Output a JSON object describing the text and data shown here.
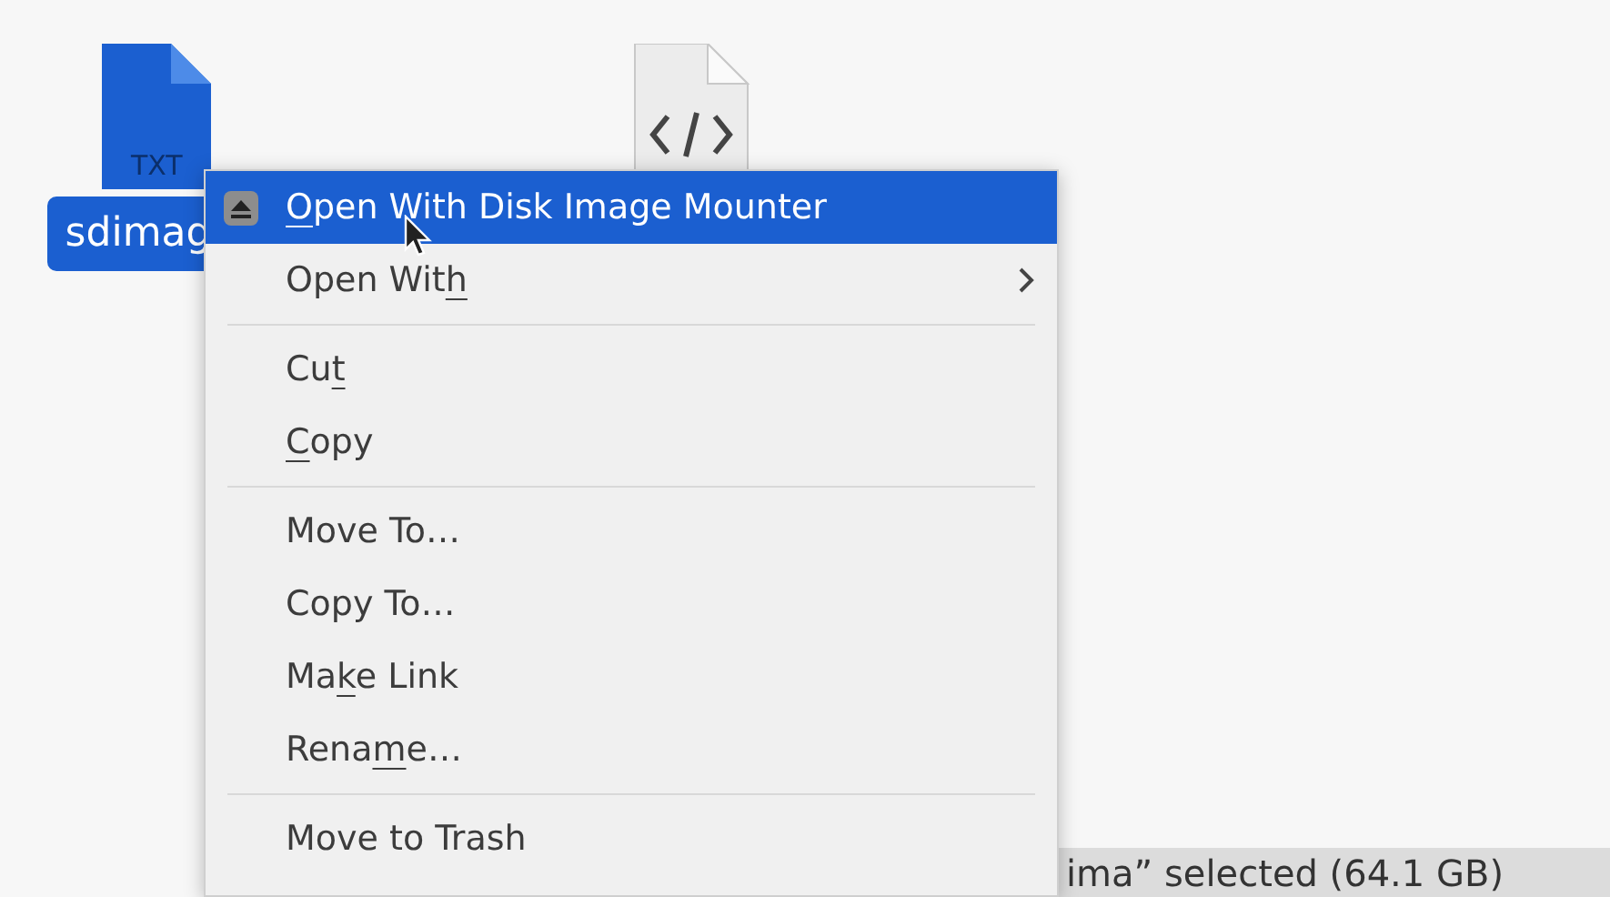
{
  "files": [
    {
      "kind": "text",
      "badge": "TXT",
      "name": "sdimag",
      "selected": true
    },
    {
      "kind": "code",
      "selected": false
    }
  ],
  "status_bar": {
    "text": "ima” selected (64.1 GB)"
  },
  "context_menu": {
    "groups": [
      [
        {
          "kind": "app",
          "selected": true,
          "label_parts": [
            {
              "text": "O",
              "underlined": true
            },
            {
              "text": "pen With Disk Image Mounter",
              "underlined": false
            }
          ]
        },
        {
          "kind": "submenu",
          "selected": false,
          "label_parts": [
            {
              "text": "Open Wit",
              "underlined": false
            },
            {
              "text": "h",
              "underlined": true
            }
          ]
        }
      ],
      [
        {
          "kind": "plain",
          "selected": false,
          "label_parts": [
            {
              "text": "Cu",
              "underlined": false
            },
            {
              "text": "t",
              "underlined": true
            }
          ]
        },
        {
          "kind": "plain",
          "selected": false,
          "label_parts": [
            {
              "text": "C",
              "underlined": true
            },
            {
              "text": "opy",
              "underlined": false
            }
          ]
        }
      ],
      [
        {
          "kind": "plain",
          "selected": false,
          "label_parts": [
            {
              "text": "Move To…",
              "underlined": false
            }
          ]
        },
        {
          "kind": "plain",
          "selected": false,
          "label_parts": [
            {
              "text": "Copy To…",
              "underlined": false
            }
          ]
        },
        {
          "kind": "plain",
          "selected": false,
          "label_parts": [
            {
              "text": "Ma",
              "underlined": false
            },
            {
              "text": "k",
              "underlined": true
            },
            {
              "text": "e Link",
              "underlined": false
            }
          ]
        },
        {
          "kind": "plain",
          "selected": false,
          "label_parts": [
            {
              "text": "Rena",
              "underlined": false
            },
            {
              "text": "m",
              "underlined": true
            },
            {
              "text": "e…",
              "underlined": false
            }
          ]
        }
      ],
      [
        {
          "kind": "plain",
          "selected": false,
          "label_parts": [
            {
              "text": "Move to Trash",
              "underlined": false
            }
          ]
        }
      ]
    ]
  }
}
